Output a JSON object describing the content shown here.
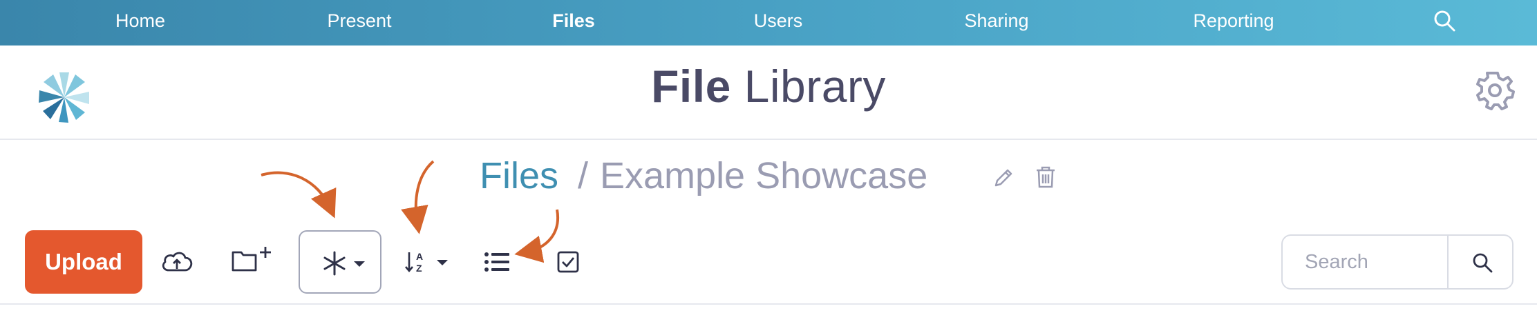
{
  "nav": {
    "items": [
      {
        "label": "Home",
        "active": false
      },
      {
        "label": "Present",
        "active": false
      },
      {
        "label": "Files",
        "active": true
      },
      {
        "label": "Users",
        "active": false
      },
      {
        "label": "Sharing",
        "active": false
      },
      {
        "label": "Reporting",
        "active": false
      }
    ],
    "search_icon": "search-icon"
  },
  "header": {
    "title_bold": "File",
    "title_rest": " Library",
    "logo_icon": "flower-logo",
    "settings_icon": "gear-icon"
  },
  "breadcrumb": {
    "root": "Files",
    "separator": "/",
    "current": "Example Showcase",
    "edit_icon": "pencil-icon",
    "delete_icon": "trash-icon"
  },
  "toolbar": {
    "upload_label": "Upload",
    "cloud_icon": "cloud-upload-icon",
    "new_folder_icon": "folder-plus-icon",
    "filter_icon": "asterisk-dropdown-icon",
    "sort_icon": "sort-az-dropdown-icon",
    "list_icon": "list-view-icon",
    "select_icon": "checkbox-icon"
  },
  "search": {
    "placeholder": "Search",
    "value": ""
  },
  "colors": {
    "nav_gradient_start": "#3a86ab",
    "nav_gradient_end": "#5abad7",
    "upload": "#e4582e",
    "breadcrumb_link": "#3f8fb1",
    "annotation_arrow": "#d4642c"
  }
}
